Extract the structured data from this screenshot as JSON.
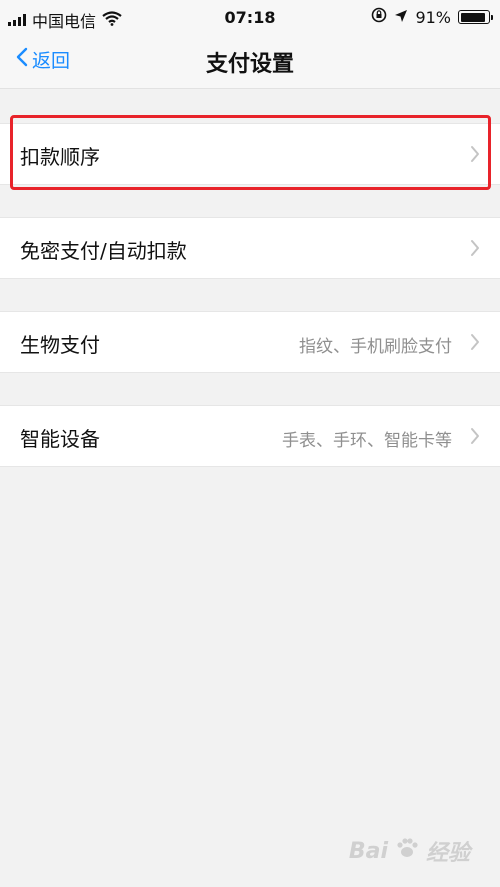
{
  "status_bar": {
    "carrier": "中国电信",
    "time": "07:18",
    "battery_percent": "91%",
    "battery_level": 0.91,
    "icons": [
      "signal-icon",
      "wifi-icon",
      "rotation-lock-icon",
      "location-icon",
      "battery-icon"
    ]
  },
  "nav": {
    "back_label": "返回",
    "title": "支付设置",
    "accent_color": "#1a8cff"
  },
  "items": [
    {
      "label": "扣款顺序",
      "detail": "",
      "highlighted": true
    },
    {
      "label": "免密支付/自动扣款",
      "detail": ""
    },
    {
      "label": "生物支付",
      "detail": "指纹、手机刷脸支付"
    },
    {
      "label": "智能设备",
      "detail": "手表、手环、智能卡等"
    }
  ],
  "watermark": {
    "brand": "Bai",
    "suffix": "经验"
  },
  "colors": {
    "background": "#f2f2f2",
    "highlight": "#e8232a",
    "detail_text": "#8f8f8f"
  }
}
